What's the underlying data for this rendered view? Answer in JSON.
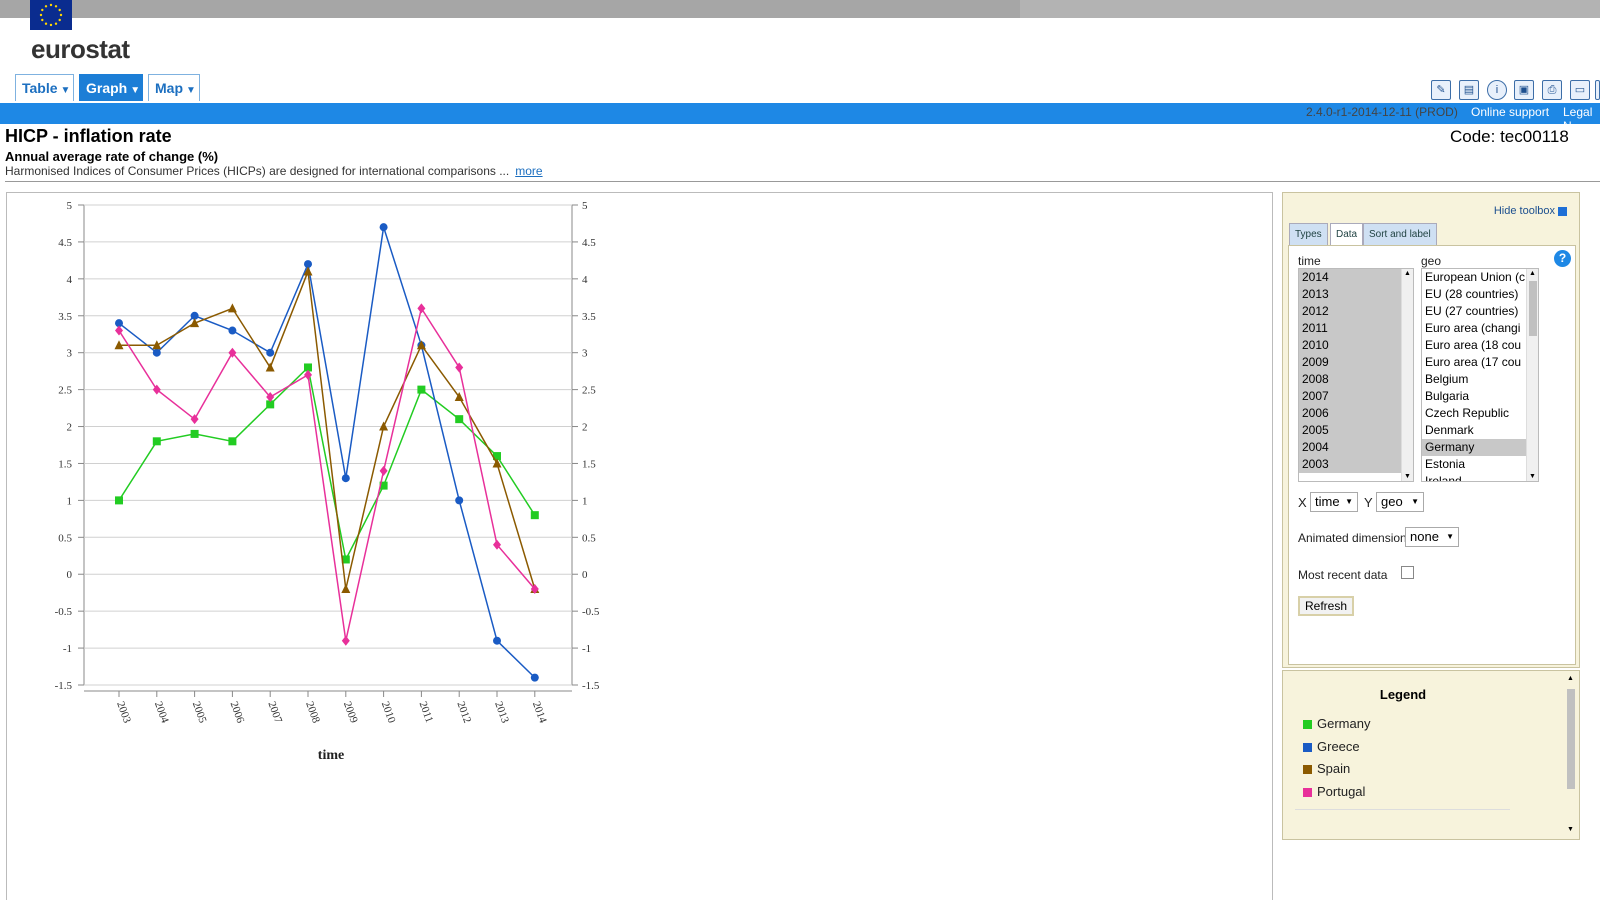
{
  "header": {
    "brand": "eurostat",
    "tabs": [
      {
        "label": "Table",
        "active": false
      },
      {
        "label": "Graph",
        "active": true
      },
      {
        "label": "Map",
        "active": false
      }
    ],
    "version": "2.4.0-r1-2014-12-11 (PROD)",
    "links": [
      "Online support",
      "Legal N"
    ],
    "tool_icons": [
      "edit-icon",
      "export-icon",
      "info-icon",
      "save-icon",
      "print-icon",
      "folder-icon",
      "more-icon"
    ]
  },
  "dataset": {
    "title": "HICP - inflation rate",
    "code": "Code: tec00118",
    "subtitle": "Annual average rate of change (%)",
    "description": "Harmonised Indices of Consumer Prices (HICPs) are designed for international comparisons ...",
    "more_label": "more"
  },
  "toolbox": {
    "hide_label": "Hide toolbox",
    "tabs": [
      {
        "label": "Types",
        "active": false
      },
      {
        "label": "Data",
        "active": true
      },
      {
        "label": "Sort and label",
        "active": false
      }
    ],
    "time_label": "time",
    "geo_label": "geo",
    "time_items": [
      "2014",
      "2013",
      "2012",
      "2011",
      "2010",
      "2009",
      "2008",
      "2007",
      "2006",
      "2005",
      "2004",
      "2003"
    ],
    "geo_items": [
      {
        "label": "European Union (c",
        "selected": false
      },
      {
        "label": "EU (28 countries)",
        "selected": false
      },
      {
        "label": "EU (27 countries)",
        "selected": false
      },
      {
        "label": "Euro area (changi",
        "selected": false
      },
      {
        "label": "Euro area (18 cou",
        "selected": false
      },
      {
        "label": "Euro area (17 cou",
        "selected": false
      },
      {
        "label": "Belgium",
        "selected": false
      },
      {
        "label": "Bulgaria",
        "selected": false
      },
      {
        "label": "Czech Republic",
        "selected": false
      },
      {
        "label": "Denmark",
        "selected": false
      },
      {
        "label": "Germany",
        "selected": true
      },
      {
        "label": "Estonia",
        "selected": false
      },
      {
        "label": "Ireland",
        "selected": false
      }
    ],
    "x_label": "X",
    "x_value": "time",
    "y_label": "Y",
    "y_value": "geo",
    "animated_label": "Animated dimension",
    "animated_value": "none",
    "most_recent_label": "Most recent data",
    "refresh_label": "Refresh"
  },
  "legend": {
    "title": "Legend",
    "items": [
      {
        "label": "Germany",
        "color": "#22cc22"
      },
      {
        "label": "Greece",
        "color": "#1a5bc4"
      },
      {
        "label": "Spain",
        "color": "#8b5a00"
      },
      {
        "label": "Portugal",
        "color": "#e8309a"
      }
    ]
  },
  "chart_data": {
    "type": "line",
    "xlabel": "time",
    "ylabel": "",
    "x": [
      "2003",
      "2004",
      "2005",
      "2006",
      "2007",
      "2008",
      "2009",
      "2010",
      "2011",
      "2012",
      "2013",
      "2014"
    ],
    "ylim": [
      -1.5,
      5
    ],
    "yticks": [
      5,
      4.5,
      4,
      3.5,
      3,
      2.5,
      2,
      1.5,
      1,
      0.5,
      0,
      -0.5,
      -1,
      -1.5
    ],
    "grid": true,
    "series": [
      {
        "name": "Germany",
        "color": "#22cc22",
        "marker": "square",
        "values": [
          1.0,
          1.8,
          1.9,
          1.8,
          2.3,
          2.8,
          0.2,
          1.2,
          2.5,
          2.1,
          1.6,
          0.8
        ]
      },
      {
        "name": "Greece",
        "color": "#1a5bc4",
        "marker": "circle",
        "values": [
          3.4,
          3.0,
          3.5,
          3.3,
          3.0,
          4.2,
          1.3,
          4.7,
          3.1,
          1.0,
          -0.9,
          -1.4
        ]
      },
      {
        "name": "Spain",
        "color": "#8b5a00",
        "marker": "triangle",
        "values": [
          3.1,
          3.1,
          3.4,
          3.6,
          2.8,
          4.1,
          -0.2,
          2.0,
          3.1,
          2.4,
          1.5,
          -0.2
        ]
      },
      {
        "name": "Portugal",
        "color": "#e8309a",
        "marker": "diamond",
        "values": [
          3.3,
          2.5,
          2.1,
          3.0,
          2.4,
          2.7,
          -0.9,
          1.4,
          3.6,
          2.8,
          0.4,
          -0.2
        ]
      }
    ]
  }
}
